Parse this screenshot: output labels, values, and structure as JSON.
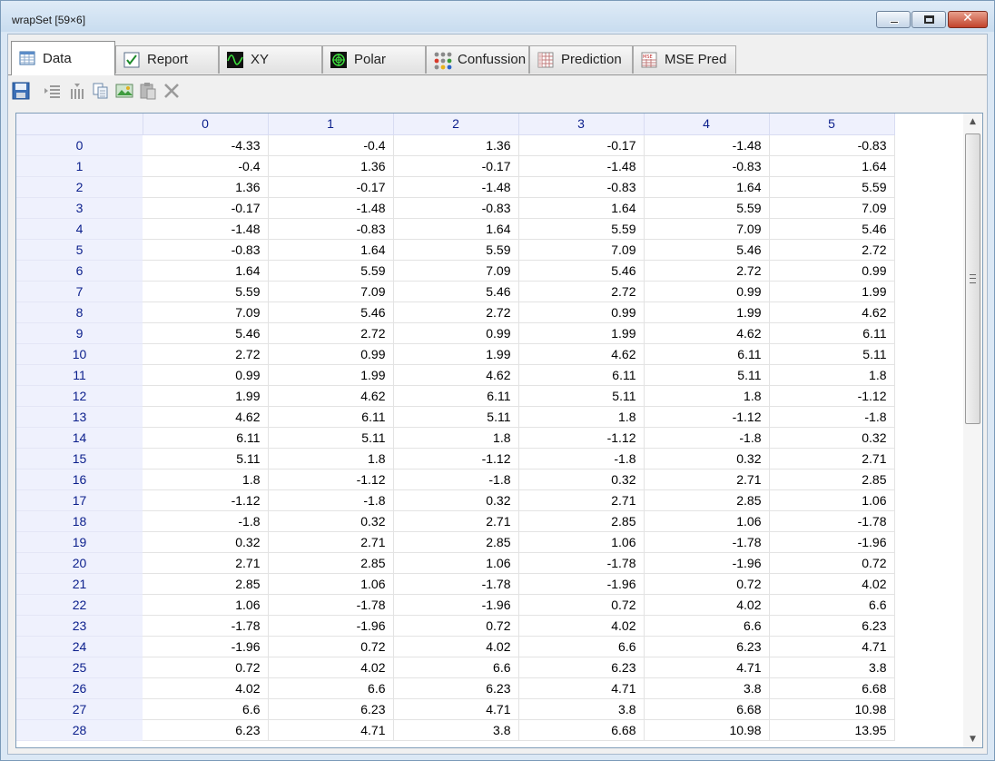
{
  "window": {
    "title": "wrapSet [59×6]"
  },
  "tabs": [
    {
      "label": "Data",
      "icon": "data-grid-icon",
      "active": true
    },
    {
      "label": "Report",
      "icon": "report-check-icon"
    },
    {
      "label": "XY",
      "icon": "xy-wave-icon"
    },
    {
      "label": "Polar",
      "icon": "polar-icon"
    },
    {
      "label": "Confussion",
      "icon": "confusion-dots-icon"
    },
    {
      "label": "Prediction",
      "icon": "prediction-grid-icon"
    },
    {
      "label": "MSE Pred",
      "icon": "mse-pred-icon"
    }
  ],
  "toolbar": [
    "save-icon",
    "insert-rows-icon",
    "insert-columns-icon",
    "copy-icon",
    "export-image-icon",
    "paste-icon",
    "delete-icon"
  ],
  "colors": {
    "header_bg": "#eff1fd",
    "header_text": "#0b1f8c"
  },
  "grid": {
    "columns": [
      "0",
      "1",
      "2",
      "3",
      "4",
      "5"
    ],
    "rows": [
      {
        "index": "0",
        "cells": [
          "-4.33",
          "-0.4",
          "1.36",
          "-0.17",
          "-1.48",
          "-0.83"
        ]
      },
      {
        "index": "1",
        "cells": [
          "-0.4",
          "1.36",
          "-0.17",
          "-1.48",
          "-0.83",
          "1.64"
        ]
      },
      {
        "index": "2",
        "cells": [
          "1.36",
          "-0.17",
          "-1.48",
          "-0.83",
          "1.64",
          "5.59"
        ]
      },
      {
        "index": "3",
        "cells": [
          "-0.17",
          "-1.48",
          "-0.83",
          "1.64",
          "5.59",
          "7.09"
        ]
      },
      {
        "index": "4",
        "cells": [
          "-1.48",
          "-0.83",
          "1.64",
          "5.59",
          "7.09",
          "5.46"
        ]
      },
      {
        "index": "5",
        "cells": [
          "-0.83",
          "1.64",
          "5.59",
          "7.09",
          "5.46",
          "2.72"
        ]
      },
      {
        "index": "6",
        "cells": [
          "1.64",
          "5.59",
          "7.09",
          "5.46",
          "2.72",
          "0.99"
        ]
      },
      {
        "index": "7",
        "cells": [
          "5.59",
          "7.09",
          "5.46",
          "2.72",
          "0.99",
          "1.99"
        ]
      },
      {
        "index": "8",
        "cells": [
          "7.09",
          "5.46",
          "2.72",
          "0.99",
          "1.99",
          "4.62"
        ]
      },
      {
        "index": "9",
        "cells": [
          "5.46",
          "2.72",
          "0.99",
          "1.99",
          "4.62",
          "6.11"
        ]
      },
      {
        "index": "10",
        "cells": [
          "2.72",
          "0.99",
          "1.99",
          "4.62",
          "6.11",
          "5.11"
        ]
      },
      {
        "index": "11",
        "cells": [
          "0.99",
          "1.99",
          "4.62",
          "6.11",
          "5.11",
          "1.8"
        ]
      },
      {
        "index": "12",
        "cells": [
          "1.99",
          "4.62",
          "6.11",
          "5.11",
          "1.8",
          "-1.12"
        ]
      },
      {
        "index": "13",
        "cells": [
          "4.62",
          "6.11",
          "5.11",
          "1.8",
          "-1.12",
          "-1.8"
        ]
      },
      {
        "index": "14",
        "cells": [
          "6.11",
          "5.11",
          "1.8",
          "-1.12",
          "-1.8",
          "0.32"
        ]
      },
      {
        "index": "15",
        "cells": [
          "5.11",
          "1.8",
          "-1.12",
          "-1.8",
          "0.32",
          "2.71"
        ]
      },
      {
        "index": "16",
        "cells": [
          "1.8",
          "-1.12",
          "-1.8",
          "0.32",
          "2.71",
          "2.85"
        ]
      },
      {
        "index": "17",
        "cells": [
          "-1.12",
          "-1.8",
          "0.32",
          "2.71",
          "2.85",
          "1.06"
        ]
      },
      {
        "index": "18",
        "cells": [
          "-1.8",
          "0.32",
          "2.71",
          "2.85",
          "1.06",
          "-1.78"
        ]
      },
      {
        "index": "19",
        "cells": [
          "0.32",
          "2.71",
          "2.85",
          "1.06",
          "-1.78",
          "-1.96"
        ]
      },
      {
        "index": "20",
        "cells": [
          "2.71",
          "2.85",
          "1.06",
          "-1.78",
          "-1.96",
          "0.72"
        ]
      },
      {
        "index": "21",
        "cells": [
          "2.85",
          "1.06",
          "-1.78",
          "-1.96",
          "0.72",
          "4.02"
        ]
      },
      {
        "index": "22",
        "cells": [
          "1.06",
          "-1.78",
          "-1.96",
          "0.72",
          "4.02",
          "6.6"
        ]
      },
      {
        "index": "23",
        "cells": [
          "-1.78",
          "-1.96",
          "0.72",
          "4.02",
          "6.6",
          "6.23"
        ]
      },
      {
        "index": "24",
        "cells": [
          "-1.96",
          "0.72",
          "4.02",
          "6.6",
          "6.23",
          "4.71"
        ]
      },
      {
        "index": "25",
        "cells": [
          "0.72",
          "4.02",
          "6.6",
          "6.23",
          "4.71",
          "3.8"
        ]
      },
      {
        "index": "26",
        "cells": [
          "4.02",
          "6.6",
          "6.23",
          "4.71",
          "3.8",
          "6.68"
        ]
      },
      {
        "index": "27",
        "cells": [
          "6.6",
          "6.23",
          "4.71",
          "3.8",
          "6.68",
          "10.98"
        ]
      },
      {
        "index": "28",
        "cells": [
          "6.23",
          "4.71",
          "3.8",
          "6.68",
          "10.98",
          "13.95"
        ]
      }
    ]
  }
}
